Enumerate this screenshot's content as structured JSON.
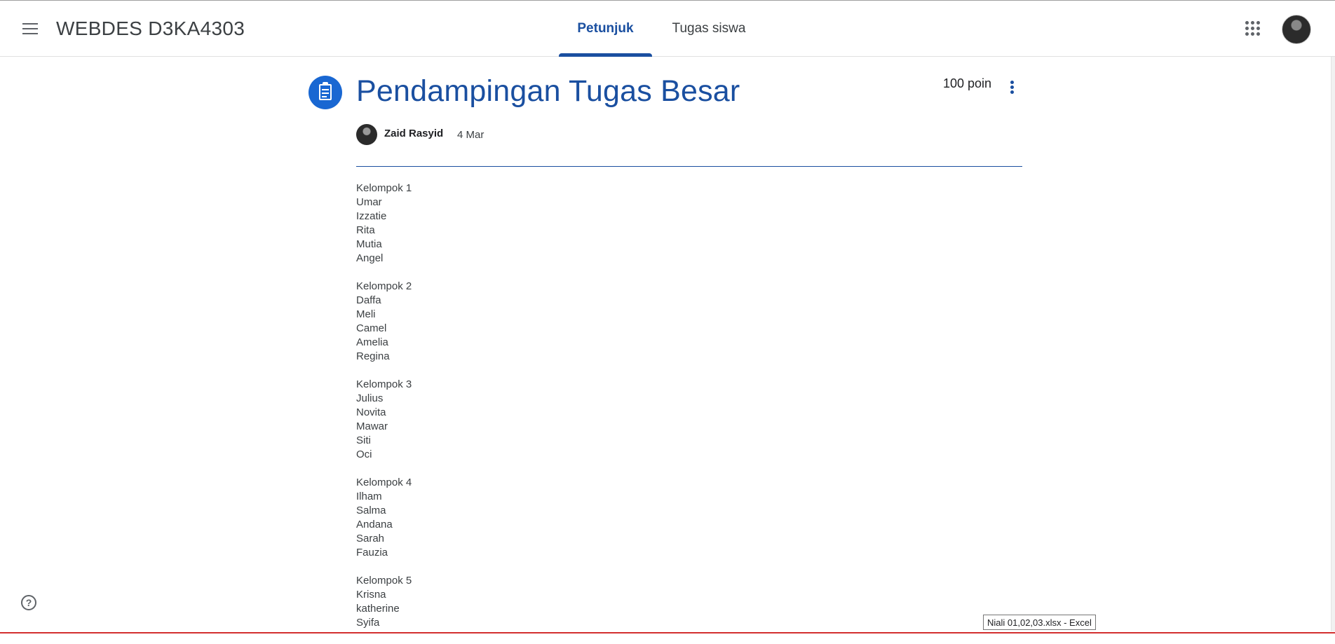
{
  "header": {
    "class_title": "WEBDES D3KA4303",
    "tabs": [
      {
        "label": "Petunjuk",
        "active": true
      },
      {
        "label": "Tugas siswa",
        "active": false
      }
    ],
    "menu_icon": "hamburger-menu-icon",
    "apps_icon": "apps-grid-icon"
  },
  "assignment": {
    "title": "Pendampingan Tugas Besar",
    "points": "100 poin",
    "author": "Zaid Rasyid",
    "date": "4 Mar",
    "accent_color": "#1a4fa0",
    "icon": "assignment-clipboard-icon"
  },
  "groups": [
    {
      "name": "Kelompok 1",
      "members": [
        "Umar",
        "Izzatie",
        "Rita",
        "Mutia",
        "Angel"
      ]
    },
    {
      "name": "Kelompok 2",
      "members": [
        "Daffa",
        "Meli",
        "Camel",
        "Amelia",
        "Regina"
      ]
    },
    {
      "name": "Kelompok 3",
      "members": [
        "Julius",
        "Novita",
        "Mawar",
        "Siti",
        "Oci"
      ]
    },
    {
      "name": "Kelompok 4",
      "members": [
        "Ilham",
        "Salma",
        "Andana",
        "Sarah",
        "Fauzia"
      ]
    },
    {
      "name": "Kelompok 5",
      "members": [
        "Krisna",
        "katherine",
        "Syifa"
      ]
    }
  ],
  "footer": {
    "help_icon": "help-circle-icon",
    "help_glyph": "?",
    "taskbar_tooltip": "Niali 01,02,03.xlsx - Excel"
  }
}
